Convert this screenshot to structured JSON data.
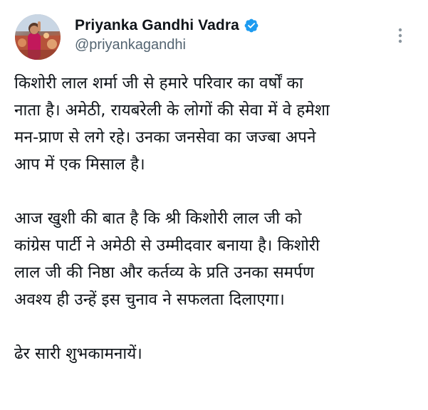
{
  "tweet": {
    "author": {
      "display_name": "Priyanka Gandhi Vadra",
      "handle": "@priyankagandhi",
      "verified_icon": "verified-badge-icon",
      "verified_color": "#1d9bf0"
    },
    "more_icon": "more-options-icon",
    "paragraphs": [
      {
        "lines": [
          "किशोरी लाल शर्मा जी से हमारे परिवार का वर्षों का",
          "नाता है। अमेठी, रायबरेली के लोगों की सेवा में वे हमेशा",
          "मन-प्राण से लगे रहे। उनका जनसेवा का जज्बा अपने",
          "आप में एक मिसाल है।"
        ]
      },
      {
        "lines": [
          "आज खुशी की बात है कि श्री किशोरी लाल जी को",
          "कांग्रेस पार्टी ने अमेठी से उम्मीदवार बनाया है। किशोरी",
          "लाल जी की निष्ठा और कर्तव्य के प्रति उनका समर्पण",
          "अवश्य ही उन्हें इस चुनाव ने सफलता दिलाएगा।"
        ]
      },
      {
        "lines": [
          "ढेर सारी शुभकामनायें।"
        ]
      }
    ]
  }
}
